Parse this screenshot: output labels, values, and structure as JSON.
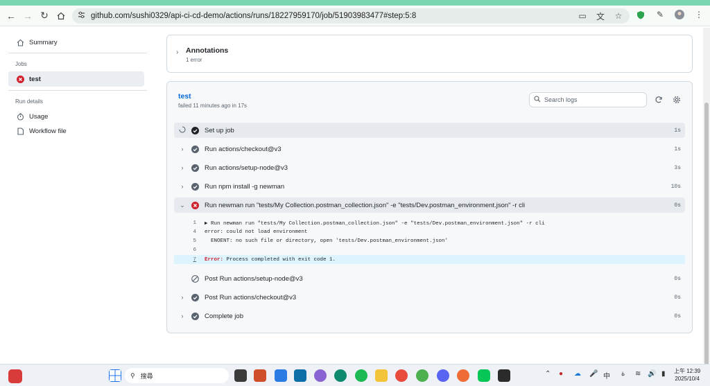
{
  "browser": {
    "url": "github.com/sushi0329/api-ci-cd-demo/actions/runs/18227959170/job/51903983477#step:5:8"
  },
  "sidebar": {
    "summary_label": "Summary",
    "jobs_heading": "Jobs",
    "job_label": "test",
    "run_details_heading": "Run details",
    "usage_label": "Usage",
    "workflow_file_label": "Workflow file"
  },
  "annotations": {
    "title": "Annotations",
    "count": "1 error"
  },
  "job": {
    "title": "test",
    "status": "failed 11 minutes ago in 17s",
    "search_placeholder": "Search logs"
  },
  "steps": [
    {
      "name": "Set up job",
      "duration": "1s",
      "status": "success"
    },
    {
      "name": "Run actions/checkout@v3",
      "duration": "1s",
      "status": "success"
    },
    {
      "name": "Run actions/setup-node@v3",
      "duration": "3s",
      "status": "success"
    },
    {
      "name": "Run npm install -g newman",
      "duration": "10s",
      "status": "success"
    },
    {
      "name": "Run newman run \"tests/My Collection.postman_collection.json\" -e \"tests/Dev.postman_environment.json\" -r cli",
      "duration": "0s",
      "status": "failure"
    },
    {
      "name": "Post Run actions/setup-node@v3",
      "duration": "0s",
      "status": "skipped"
    },
    {
      "name": "Post Run actions/checkout@v3",
      "duration": "0s",
      "status": "success"
    },
    {
      "name": "Complete job",
      "duration": "0s",
      "status": "success"
    }
  ],
  "log_lines": [
    {
      "num": "1",
      "text": "▶ Run newman run \"tests/My Collection.postman_collection.json\" -e \"tests/Dev.postman_environment.json\" -r cli"
    },
    {
      "num": "4",
      "text": "error: could not load environment"
    },
    {
      "num": "5",
      "text": "  ENOENT: no such file or directory, open 'tests/Dev.postman_environment.json'"
    },
    {
      "num": "6",
      "text": ""
    },
    {
      "num": "7",
      "error_keyword": "Error:",
      "text": " Process completed with exit code 1."
    }
  ],
  "taskbar": {
    "search_text": "搜尋",
    "ime_label": "中",
    "time": "上午 12:39",
    "date": "2025/10/4"
  },
  "colors": {
    "success": "#59636e",
    "failure": "#cf222e",
    "link": "#0969da",
    "browser_accent": "#7ad6b0"
  }
}
